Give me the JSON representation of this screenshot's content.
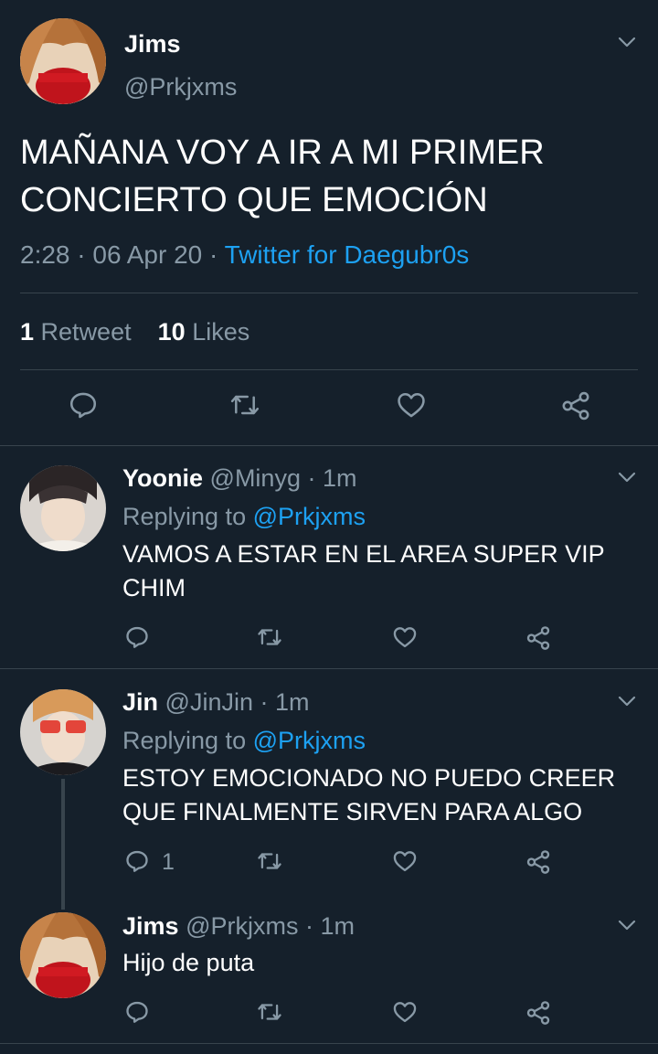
{
  "main_tweet": {
    "name": "Jims",
    "handle": "@Prkjxms",
    "text_line1": "MAÑANA VOY A IR A MI PRIMER",
    "text_line2": "CONCIERTO QUE EMOCIÓN",
    "time": "2:28 · 06 Apr 20 · ",
    "source": "Twitter for Daegubr0s",
    "retweet_count": "1",
    "retweet_label": "Retweet",
    "like_count": "10",
    "like_label": "Likes"
  },
  "replies": [
    {
      "name": "Yoonie",
      "handle_time": "@Minyg · 1m",
      "replying_label": "Replying to ",
      "replying_to": "@Prkjxms",
      "text_line1": "VAMOS A ESTAR EN EL AREA SUPER VIP",
      "text_line2": "CHIM"
    },
    {
      "name": "Jin",
      "handle_time": "@JinJin · 1m",
      "replying_label": "Replying to ",
      "replying_to": "@Prkjxms",
      "text_line1": "ESTOY EMOCIONADO NO PUEDO CREER",
      "text_line2": "QUE FINALMENTE SIRVEN PARA ALGO",
      "reply_count": "1"
    },
    {
      "name": "Jims",
      "handle_time": "@Prkjxms · 1m",
      "text_line1": "Hijo de puta"
    }
  ],
  "icons": [
    "reply-icon",
    "retweet-icon",
    "like-icon",
    "share-icon",
    "chevron-down-icon"
  ],
  "colors": {
    "background": "#15202b",
    "accent": "#1da1f2",
    "muted": "#8899a6",
    "divider": "#38444d"
  }
}
